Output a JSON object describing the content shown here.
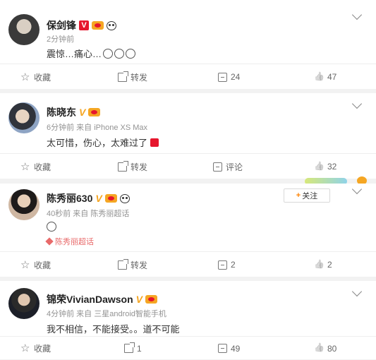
{
  "posts": [
    {
      "username": "保剑锋",
      "meta": "2分钟前",
      "text": "震惊…痛心…",
      "actions": {
        "favorite": "收藏",
        "repost": "转发",
        "comments": "24",
        "likes": "47"
      }
    },
    {
      "username": "陈晓东",
      "meta": "6分钟前 来自 iPhone XS Max",
      "text": "太可惜，伤心，太难过了",
      "actions": {
        "favorite": "收藏",
        "repost": "转发",
        "comments": "评论",
        "likes": "32"
      }
    },
    {
      "username": "陈秀丽630",
      "meta": "40秒前 来自 陈秀丽超话",
      "supertopic": "陈秀丽超话",
      "follow_label": "关注",
      "follow_plus": "+",
      "actions": {
        "favorite": "收藏",
        "repost": "转发",
        "comments": "2",
        "likes": "2"
      }
    },
    {
      "username": "锦荣VivianDawson",
      "meta": "4分钟前 来自 三星android智能手机",
      "text": "我不相信，不能接受。。道不可能",
      "actions": {
        "favorite": "收藏",
        "repost": "1",
        "comments": "49",
        "likes": "80"
      }
    }
  ],
  "colors": {
    "accent_orange": "#ff8200",
    "verified_gold": "#f5a623",
    "verified_red": "#e6162d",
    "supertopic_red": "#e86a6a"
  },
  "icons": [
    "star-icon",
    "share-icon",
    "comment-icon",
    "like-icon",
    "chevron-down-icon",
    "verified-badge-icon",
    "vip-crown-icon",
    "panda-icon",
    "diamond-icon"
  ]
}
